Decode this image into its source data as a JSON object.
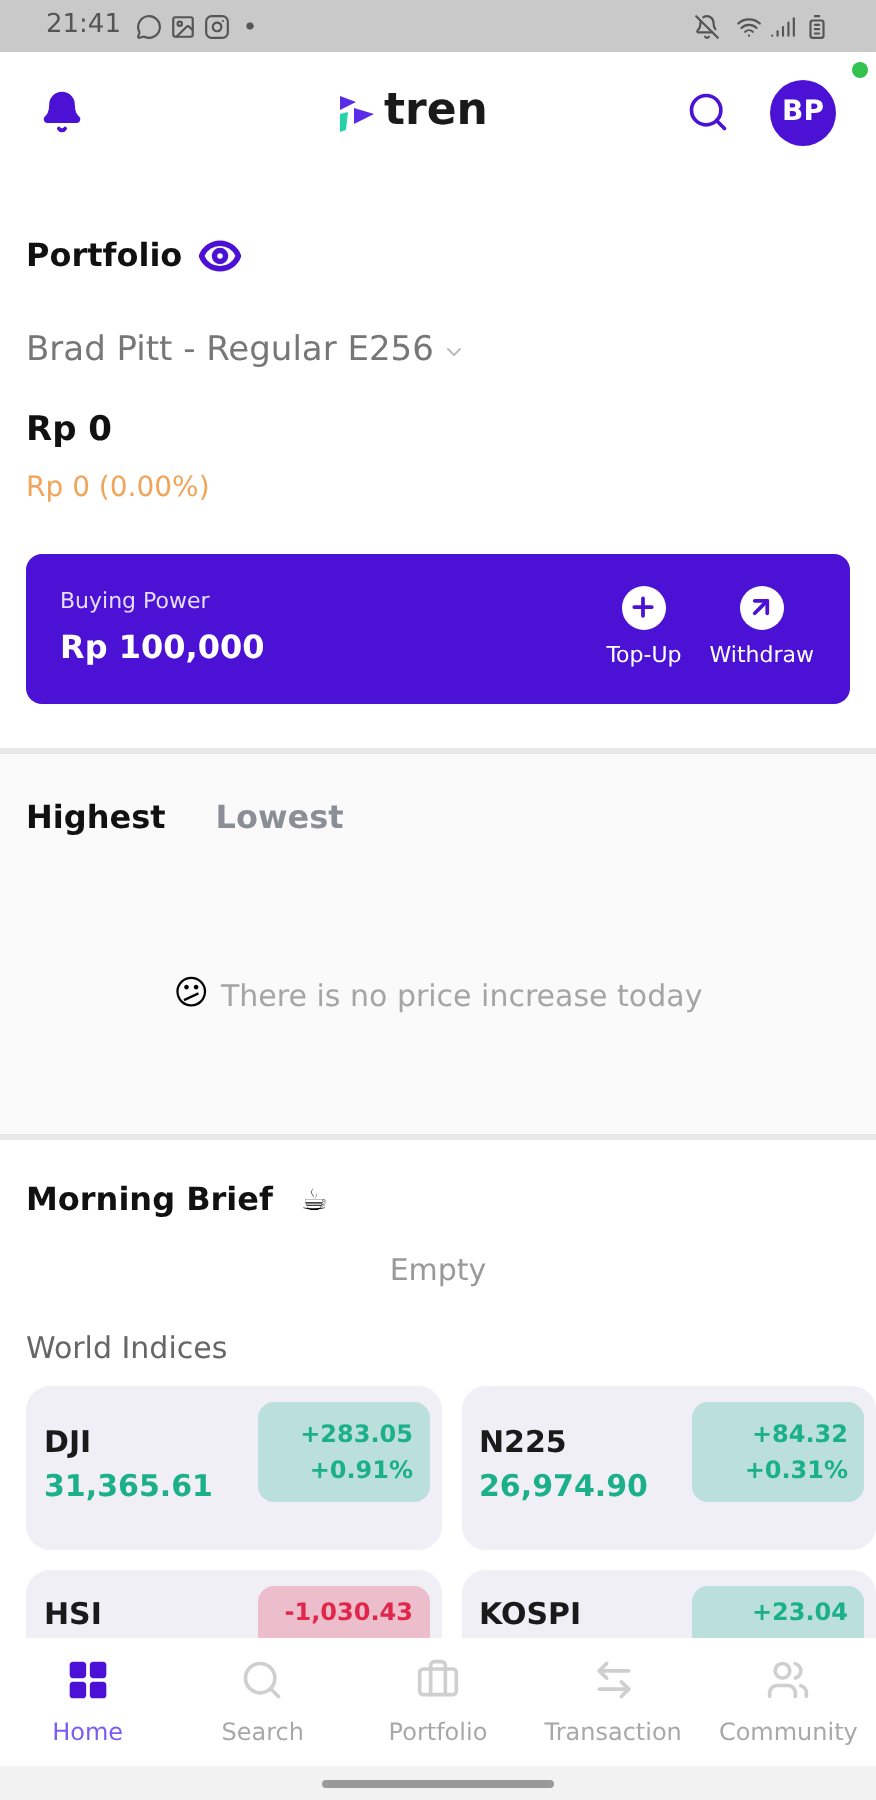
{
  "status_bar": {
    "time": "21:41"
  },
  "header": {
    "logo_text": "tren",
    "avatar": "BP",
    "online": true
  },
  "portfolio": {
    "title": "Portfolio",
    "account": "Brad Pitt - Regular E256",
    "value": "Rp 0",
    "change": "Rp 0 (0.00%)"
  },
  "buying_power": {
    "label": "Buying Power",
    "amount": "Rp 100,000",
    "actions": [
      {
        "kind": "topup",
        "label": "Top-Up"
      },
      {
        "kind": "withdraw",
        "label": "Withdraw"
      }
    ]
  },
  "movers": {
    "tabs": [
      {
        "label": "Highest",
        "selected": true
      },
      {
        "label": "Lowest",
        "selected": false
      }
    ],
    "empty_emoji": "😕",
    "empty_message": "There is no price increase today"
  },
  "morning_brief": {
    "title": "Morning Brief",
    "emoji": "☕",
    "empty": "Empty"
  },
  "world_indices": {
    "title": "World Indices",
    "items": [
      {
        "name": "DJI",
        "value": "31,365.61",
        "change": "+283.05",
        "percent": "+0.91%",
        "color": "#1bb08a"
      },
      {
        "name": "N225",
        "value": "26,974.90",
        "change": "+84.32",
        "percent": "+0.31%",
        "color": "#1bb08a"
      },
      {
        "name": "HSI",
        "change": "-1,030.43",
        "color": "#e0264a"
      },
      {
        "name": "KOSPI",
        "change": "+23.04",
        "color": "#1bb08a"
      }
    ]
  },
  "bottom_nav": [
    {
      "kind": "home",
      "label": "Home",
      "selected": true
    },
    {
      "kind": "search",
      "label": "Search",
      "selected": false
    },
    {
      "kind": "portfolio",
      "label": "Portfolio",
      "selected": false
    },
    {
      "kind": "transaction",
      "label": "Transaction",
      "selected": false
    },
    {
      "kind": "community",
      "label": "Community",
      "selected": false
    }
  ]
}
